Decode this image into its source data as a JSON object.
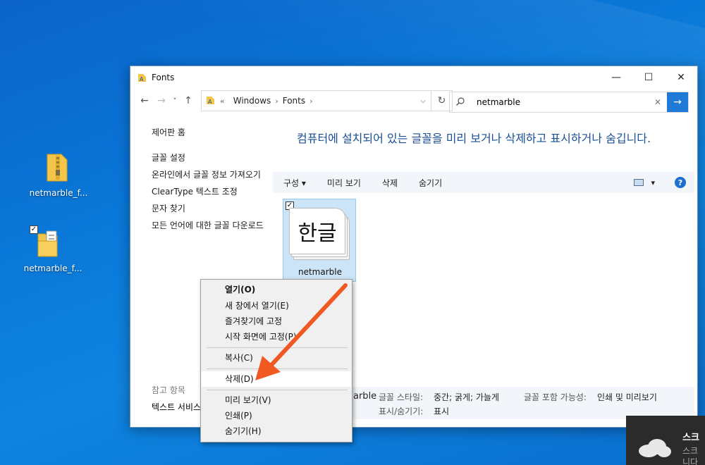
{
  "desktop": {
    "icons": [
      {
        "label": "netmarble_f...",
        "checked": false
      },
      {
        "label": "netmarble_f...",
        "checked": true
      }
    ]
  },
  "window": {
    "title": "Fonts",
    "controls": {
      "minimize": "—",
      "maximize": "☐",
      "close": "✕"
    }
  },
  "nav": {
    "back": "←",
    "forward": "→",
    "recent": "˅",
    "up": "↑",
    "breadcrumb": [
      "«",
      "Windows",
      "Fonts"
    ],
    "refresh": "↻"
  },
  "search": {
    "value": "netmarble",
    "clear": "✕",
    "go": "→"
  },
  "sidebar": {
    "items": [
      "제어판 홈",
      "글꼴 설정",
      "온라인에서 글꼴 정보 가져오기",
      "ClearType 텍스트 조정",
      "문자 찾기",
      "모든 언어에 대한 글꼴 다운로드"
    ],
    "see_also_header": "참고 항목",
    "see_also_item": "텍스트 서비스"
  },
  "heading": "컴퓨터에 설치되어 있는 글꼴을 미리 보거나 삭제하고 표시하거나 숨깁니다.",
  "toolbar": {
    "organize": "구성 ▾",
    "preview": "미리 보기",
    "delete": "삭제",
    "hide": "숨기기",
    "view_arrow": "▾",
    "help": "?"
  },
  "font_item": {
    "sample": "한글",
    "name": "netmarble",
    "checked": true
  },
  "details": {
    "name_tail": "arble",
    "style_label": "글꼴 스타일:",
    "style_value": "중간; 굵게; 가늘게",
    "embed_label": "글꼴 포함 가능성:",
    "embed_value": "인쇄 및 미리보기",
    "visibility_label": "표시/숨기기:",
    "visibility_value": "표시"
  },
  "context_menu": {
    "items": [
      {
        "label": "열기(O)",
        "bold": true
      },
      {
        "label": "새 창에서 열기(E)"
      },
      {
        "label": "즐겨찾기에 고정"
      },
      {
        "label": "시작 화면에 고정(P)"
      },
      {
        "label": "복사(C)"
      },
      {
        "label": "삭제(D)",
        "highlighted": true
      },
      {
        "label": "미리 보기(V)"
      },
      {
        "label": "인쇄(P)"
      },
      {
        "label": "숨기기(H)"
      }
    ]
  },
  "toast": {
    "title": "스크",
    "line1": "스크",
    "line2": "니다"
  },
  "colors": {
    "accent": "#1e7ad6",
    "arrow": "#f05a22",
    "heading": "#1a4f96",
    "selection": "#cce4f7"
  }
}
